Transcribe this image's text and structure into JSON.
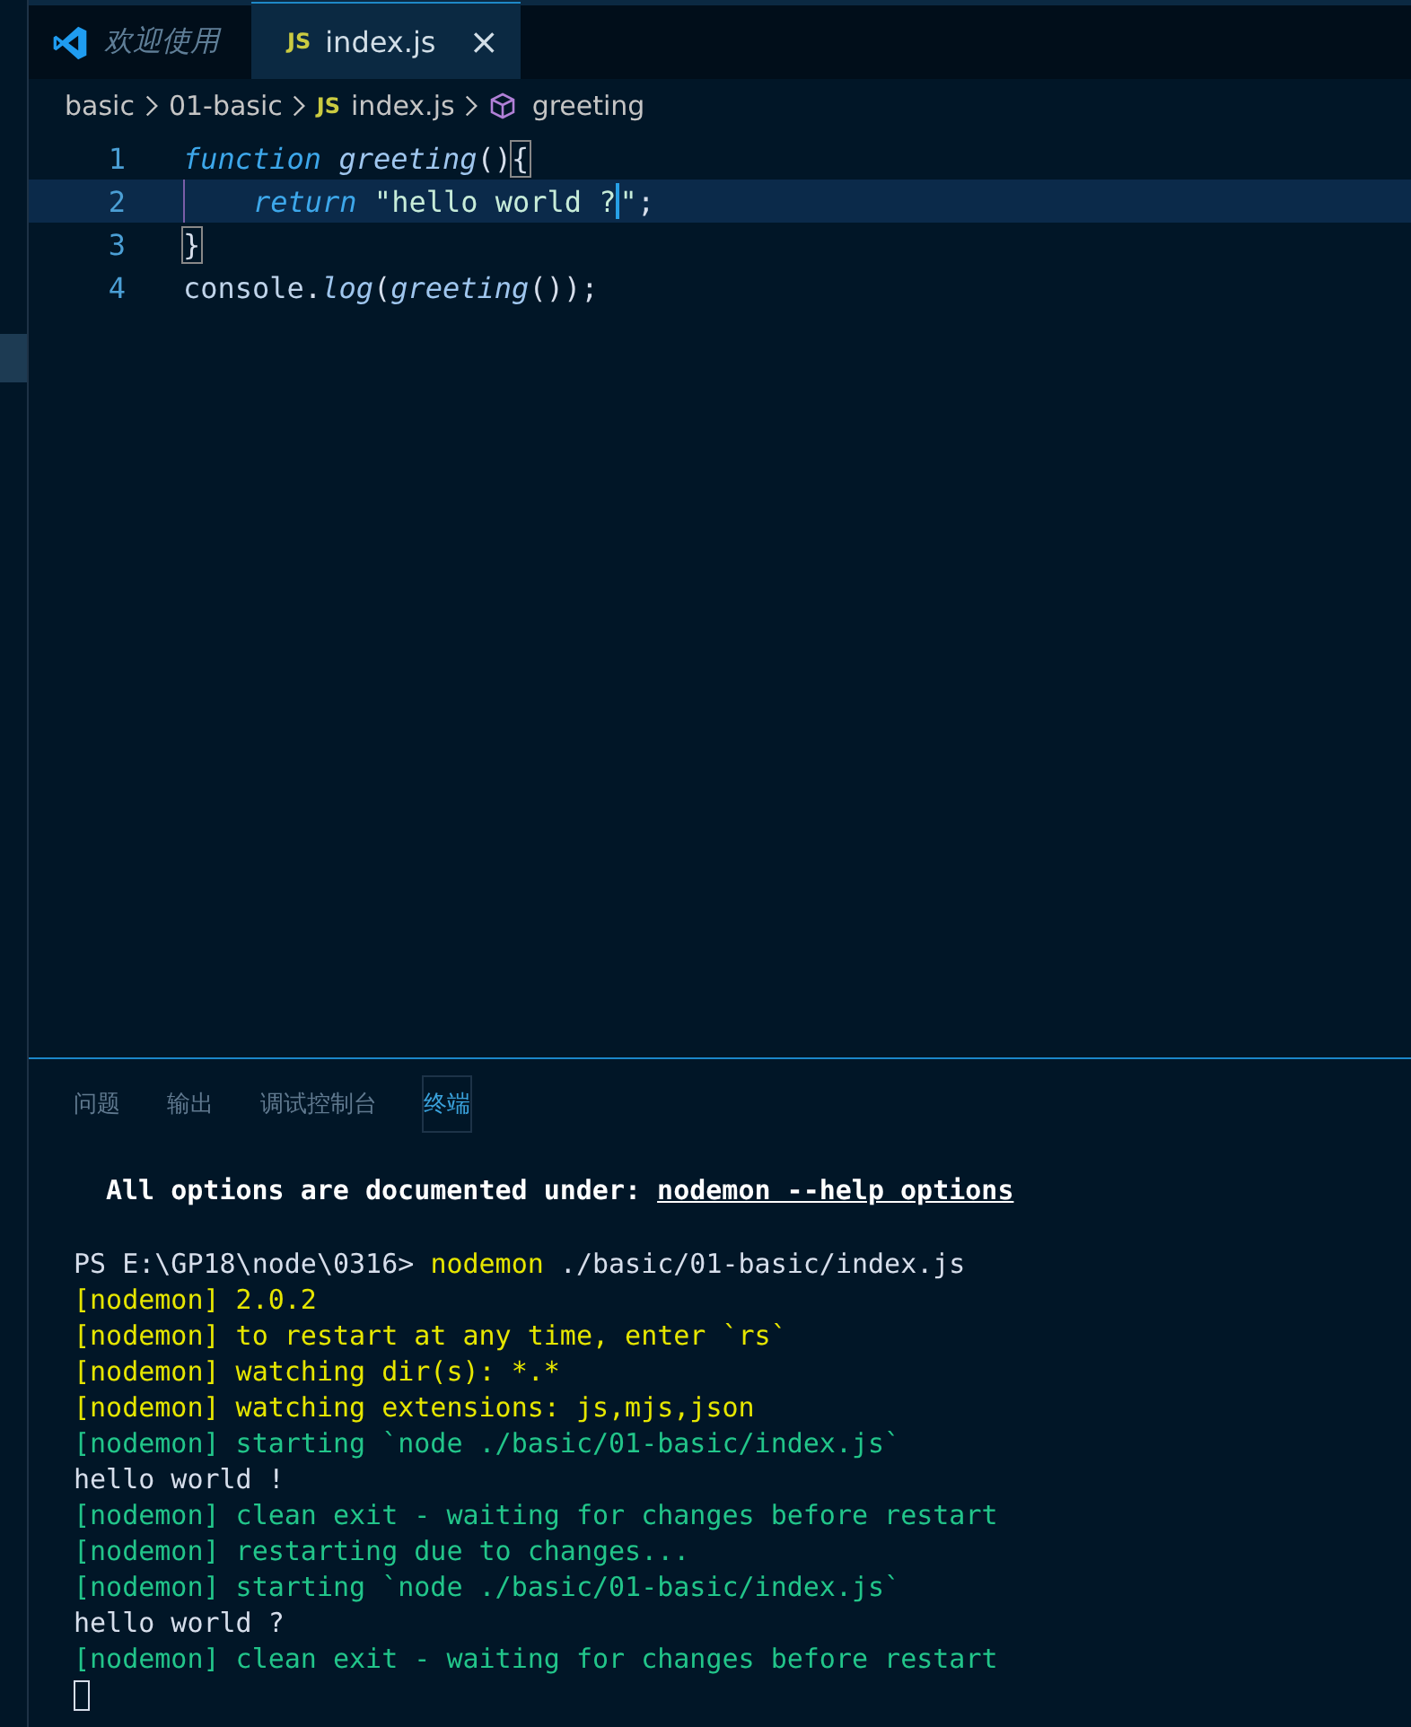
{
  "tabs": [
    {
      "label": "欢迎使用",
      "kind": "welcome",
      "selected": false
    },
    {
      "label": "index.js",
      "kind": "js",
      "icon_text": "JS",
      "selected": true,
      "close": "×"
    }
  ],
  "breadcrumb": [
    {
      "text": "basic",
      "kind": "folder"
    },
    {
      "text": "01-basic",
      "kind": "folder"
    },
    {
      "text": "index.js",
      "kind": "js",
      "icon_text": "JS"
    },
    {
      "text": "greeting",
      "kind": "symbol"
    }
  ],
  "code": [
    {
      "number": "1",
      "current": false,
      "indented": false,
      "tokens": [
        {
          "text": "function",
          "kind": "keyword"
        },
        {
          "text": " greeting",
          "kind": "func"
        },
        {
          "text": "()",
          "kind": "punct"
        },
        {
          "text": "{",
          "kind": "bracket"
        }
      ]
    },
    {
      "number": "2",
      "current": true,
      "indented": true,
      "tokens": [
        {
          "text": "return",
          "kind": "keyword"
        },
        {
          "text": " \"hello world ?",
          "kind": "string",
          "caret": true
        },
        {
          "text": "\"",
          "kind": "string"
        },
        {
          "text": ";",
          "kind": "punct"
        }
      ]
    },
    {
      "number": "3",
      "current": false,
      "indented": false,
      "tokens": [
        {
          "text": "}",
          "kind": "bracket"
        }
      ]
    },
    {
      "number": "4",
      "current": false,
      "indented": false,
      "tokens": [
        {
          "text": "console",
          "kind": "plain"
        },
        {
          "text": ".",
          "kind": "punct"
        },
        {
          "text": "log",
          "kind": "func"
        },
        {
          "text": "(",
          "kind": "punct"
        },
        {
          "text": "greeting",
          "kind": "func"
        },
        {
          "text": "());",
          "kind": "punct"
        }
      ]
    }
  ],
  "panel_tabs": [
    {
      "label": "问题",
      "selected": false
    },
    {
      "label": "输出",
      "selected": false
    },
    {
      "label": "调试控制台",
      "selected": false
    },
    {
      "label": "终端",
      "selected": true
    }
  ],
  "terminal": {
    "notice": [
      {
        "text": "All options are documented under: ",
        "kind": "bold"
      },
      {
        "text": "nodemon --help options",
        "kind": "link"
      }
    ],
    "lines": [
      [
        {
          "text": "PS E:\\GP18\\node\\0316> ",
          "kind": "white"
        },
        {
          "text": "nodemon",
          "kind": "yellow"
        },
        {
          "text": " ./basic/01-basic/index.js",
          "kind": "white"
        }
      ],
      [
        {
          "text": "[nodemon] 2.0.2",
          "kind": "yellow"
        }
      ],
      [
        {
          "text": "[nodemon] to restart at any time, enter `rs`",
          "kind": "yellow"
        }
      ],
      [
        {
          "text": "[nodemon] watching dir(s): *.*",
          "kind": "yellow"
        }
      ],
      [
        {
          "text": "[nodemon] watching extensions: js,mjs,json",
          "kind": "yellow"
        }
      ],
      [
        {
          "text": "[nodemon] starting `node ./basic/01-basic/index.js`",
          "kind": "green"
        }
      ],
      [
        {
          "text": "hello world !",
          "kind": "white"
        }
      ],
      [
        {
          "text": "[nodemon] clean exit - waiting for changes before restart",
          "kind": "green"
        }
      ],
      [
        {
          "text": "[nodemon] restarting due to changes...",
          "kind": "green"
        }
      ],
      [
        {
          "text": "[nodemon] starting `node ./basic/01-basic/index.js`",
          "kind": "green"
        }
      ],
      [
        {
          "text": "hello world ?",
          "kind": "white"
        }
      ],
      [
        {
          "text": "[nodemon] clean exit - waiting for changes before restart",
          "kind": "green"
        }
      ]
    ]
  }
}
